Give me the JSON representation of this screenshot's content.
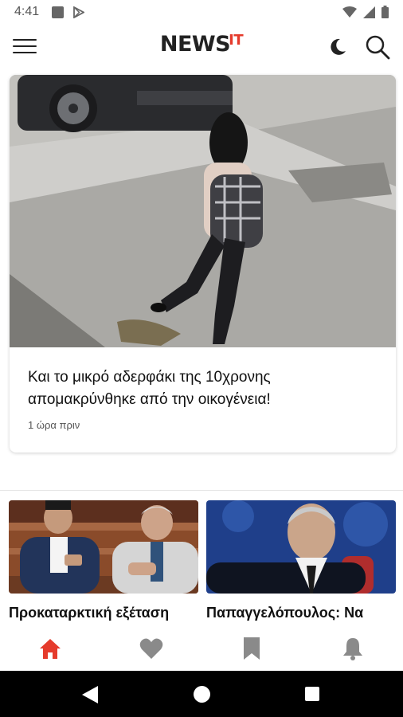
{
  "status_bar": {
    "time": "4:41",
    "left_icons": [
      "stop-icon",
      "play-store-icon"
    ],
    "right_icons": [
      "wifi-icon",
      "signal-icon",
      "battery-icon"
    ]
  },
  "header": {
    "logo_main": "NEWS",
    "logo_accent": "IT",
    "icons": [
      "hamburger-menu-icon",
      "moon-icon",
      "search-icon"
    ]
  },
  "hero": {
    "title": "Και το μικρό αδερφάκι της 10χρονης απομακρύνθηκε από την οικογένεια!",
    "time": "1 ώρα πριν"
  },
  "articles": [
    {
      "title": "Προκαταρκτική εξέταση"
    },
    {
      "title": "Παπαγγελόπουλος: Να"
    }
  ],
  "bottom_nav": {
    "tabs": [
      "home-icon",
      "heart-icon",
      "bookmark-icon",
      "bell-icon"
    ],
    "active_color": "#e53b2c",
    "inactive_color": "#8a8a8a"
  }
}
